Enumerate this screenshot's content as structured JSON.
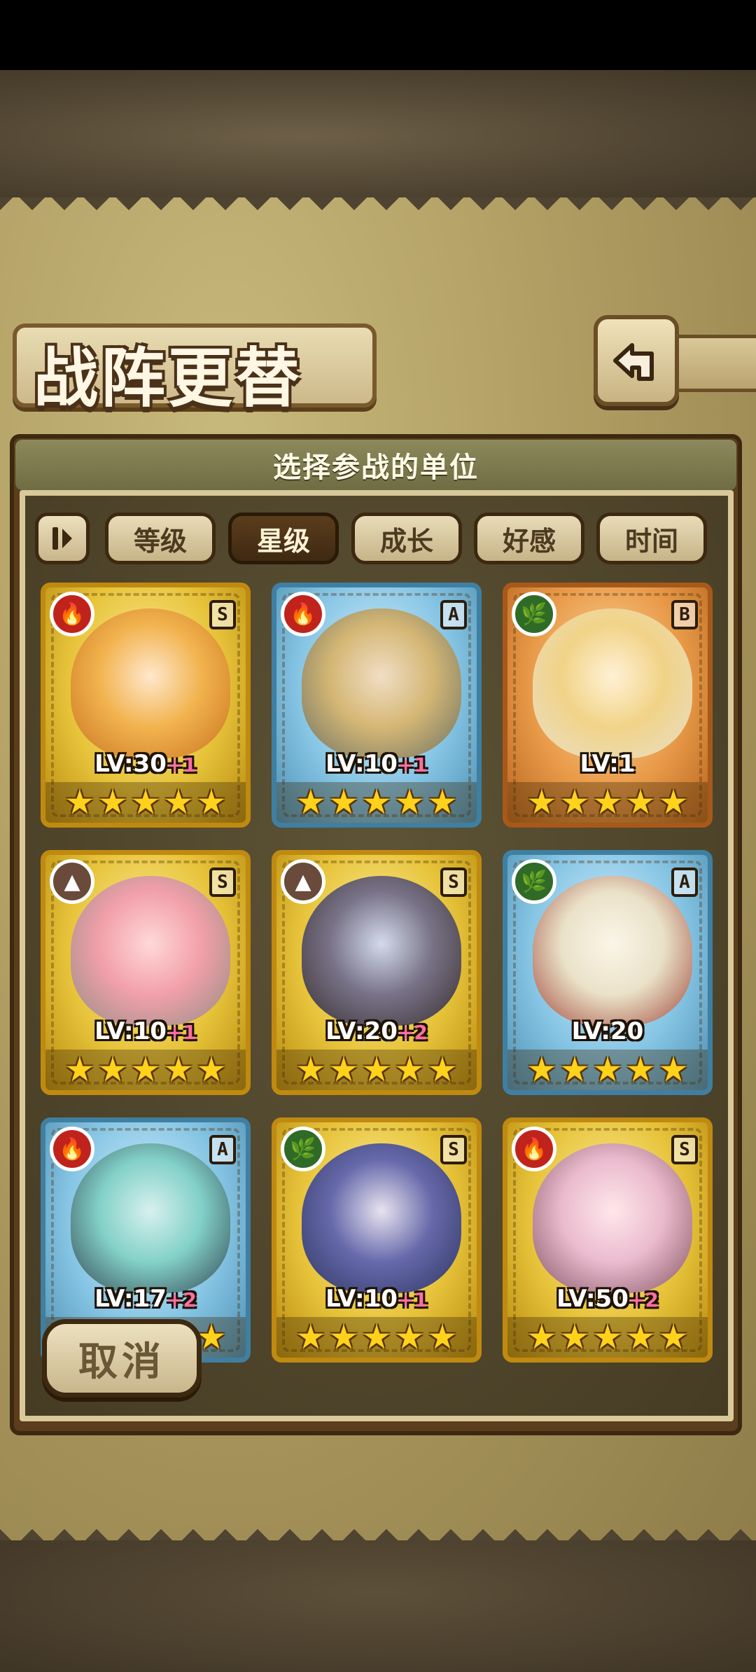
{
  "header": {
    "title": "战阵更替",
    "subtitle": "选择参战的单位"
  },
  "sort": {
    "tabs": [
      {
        "label": "等级"
      },
      {
        "label": "星级"
      },
      {
        "label": "成长"
      },
      {
        "label": "好感"
      },
      {
        "label": "时间"
      }
    ],
    "active": "星级"
  },
  "units": [
    {
      "level": "LV:30",
      "bonus": "+1",
      "rank": "S",
      "element": "fire",
      "frame": "gold",
      "stars": 5
    },
    {
      "level": "LV:10",
      "bonus": "+1",
      "rank": "A",
      "element": "fire",
      "frame": "blue",
      "stars": 5
    },
    {
      "level": "LV:1",
      "bonus": "",
      "rank": "B",
      "element": "leaf",
      "frame": "bronze",
      "stars": 5
    },
    {
      "level": "LV:10",
      "bonus": "+1",
      "rank": "S",
      "element": "earth",
      "frame": "gold",
      "stars": 5
    },
    {
      "level": "LV:20",
      "bonus": "+2",
      "rank": "S",
      "element": "earth",
      "frame": "gold",
      "stars": 5
    },
    {
      "level": "LV:20",
      "bonus": "",
      "rank": "A",
      "element": "leaf",
      "frame": "blue",
      "stars": 5
    },
    {
      "level": "LV:17",
      "bonus": "+2",
      "rank": "A",
      "element": "fire",
      "frame": "blue",
      "stars": 5
    },
    {
      "level": "LV:10",
      "bonus": "+1",
      "rank": "S",
      "element": "leaf",
      "frame": "gold",
      "stars": 5
    },
    {
      "level": "LV:50",
      "bonus": "+2",
      "rank": "S",
      "element": "fire",
      "frame": "gold",
      "stars": 5
    }
  ],
  "footer": {
    "cancel_label": "取消"
  },
  "icons": {
    "back": "back-arrow-icon",
    "toggle": "sort-order-icon",
    "fire": "fire-element-icon",
    "leaf": "leaf-element-icon",
    "earth": "earth-element-icon",
    "star": "star-icon"
  },
  "colors": {
    "fire": "#c0231c",
    "leaf": "#2f6b27",
    "earth": "#6a4a3a",
    "gold_frame": "#c08a10",
    "blue_frame": "#3f7fa2",
    "bronze_frame": "#a7591a",
    "bonus": "#ff6fa1"
  }
}
